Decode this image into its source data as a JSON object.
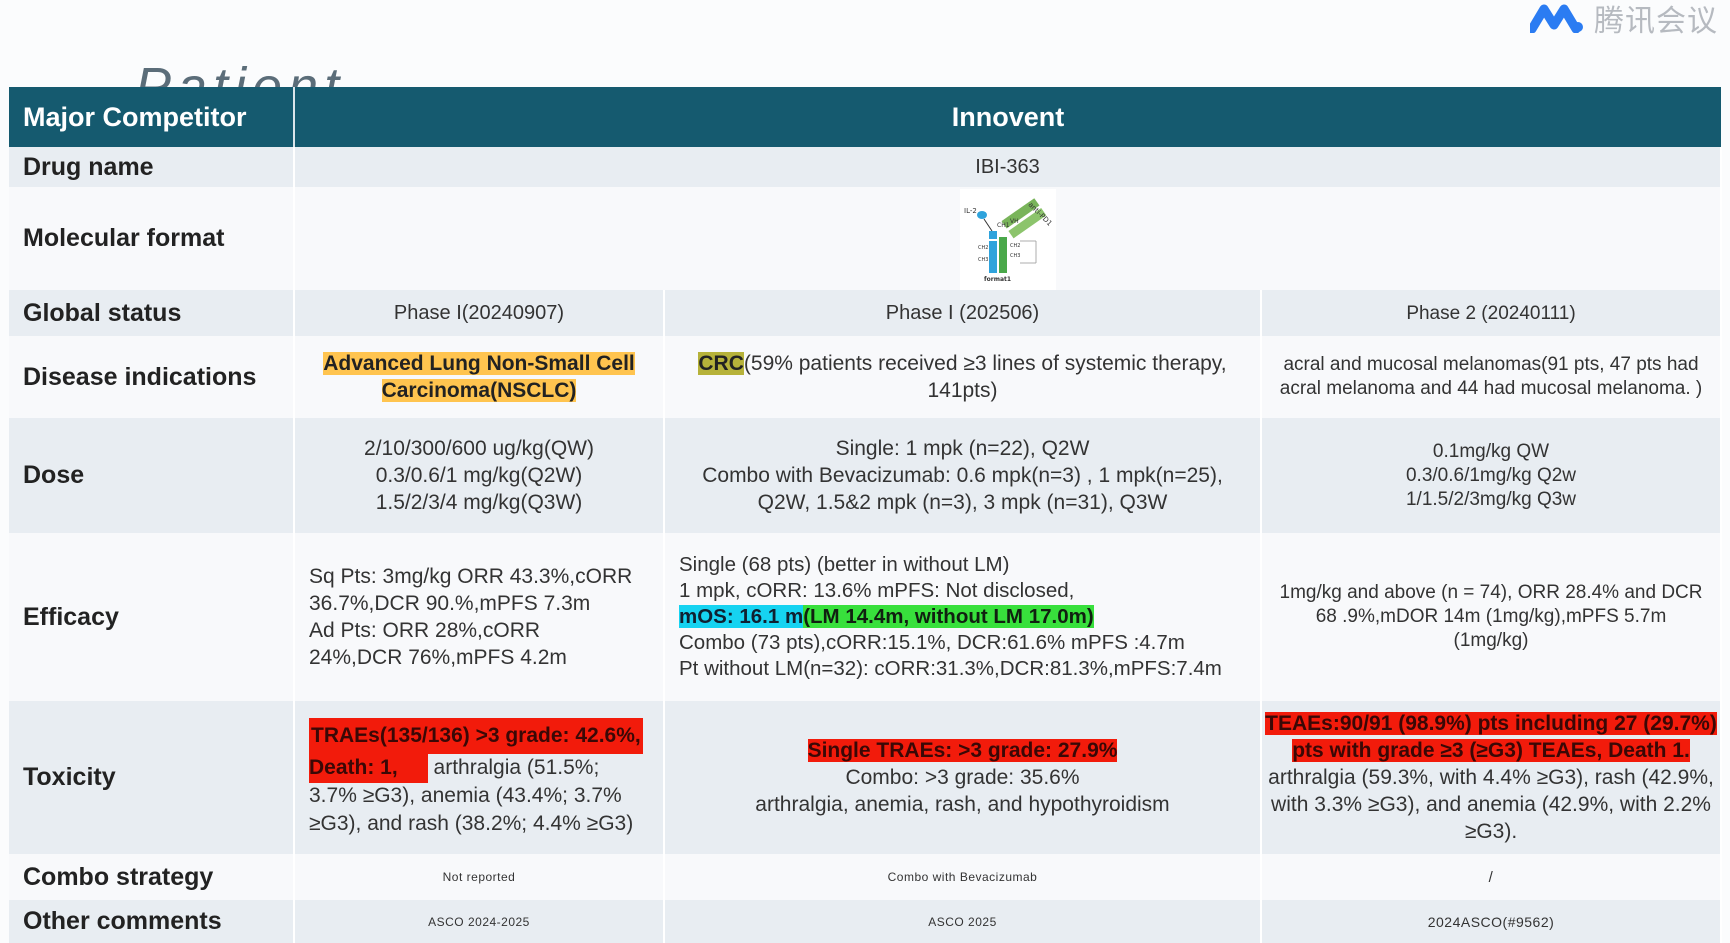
{
  "overlay": {
    "app_label": "腾讯会议",
    "ghost_title": "Patient selection"
  },
  "table": {
    "header": {
      "competitor_label": "Major Competitor",
      "company": "Innovent"
    },
    "rows": {
      "drug_name": {
        "label": "Drug name",
        "value": "IBI-363"
      },
      "molecular_format": {
        "label": "Molecular format",
        "diagram": {
          "il2": "IL-2",
          "anti_pd1": "anti-PD1",
          "ch1": "CH1",
          "ch2": "CH2",
          "ch3": "CH3",
          "vh": "VH",
          "bottom": "format1"
        }
      },
      "global_status": {
        "label": "Global status",
        "col1": "Phase I(20240907)",
        "col2": "Phase I (202506)",
        "col3": "Phase 2 (20240111)"
      },
      "disease_indications": {
        "label": "Disease indications",
        "col1": "Advanced Lung Non-Small Cell Carcinoma(NSCLC)",
        "col2_highlight": "CRC",
        "col2_rest": "(59% patients received ≥3 lines of systemic therapy, 141pts)",
        "col3": "acral and mucosal melanomas(91 pts, 47 pts had acral melanoma and 44 had mucosal melanoma. )"
      },
      "dose": {
        "label": "Dose",
        "col1": [
          "2/10/300/600 ug/kg(QW)",
          "0.3/0.6/1 mg/kg(Q2W)",
          "1.5/2/3/4 mg/kg(Q3W)"
        ],
        "col2": [
          "Single: 1 mpk (n=22), Q2W",
          "Combo with Bevacizumab: 0.6 mpk(n=3) , 1 mpk(n=25),",
          "Q2W, 1.5&2 mpk (n=3), 3 mpk (n=31), Q3W"
        ],
        "col3": [
          "0.1mg/kg QW",
          "0.3/0.6/1mg/kg Q2w",
          "1/1.5/2/3mg/kg Q3w"
        ]
      },
      "efficacy": {
        "label": "Efficacy",
        "col1": [
          "Sq Pts: 3mg/kg ORR 43.3%,cORR 36.7%,DCR 90.%,mPFS 7.3m",
          "Ad Pts: ORR 28%,cORR 24%,DCR 76%,mPFS 4.2m"
        ],
        "col2_lines": [
          "Single (68 pts) (better in without LM)",
          "1 mpk, cORR: 13.6% mPFS: Not disclosed,"
        ],
        "col2_cyan": "mOS: 16.1 m",
        "col2_green": "(LM 14.4m, without LM 17.0m)",
        "col2_after": [
          "Combo (73 pts),cORR:15.1%, DCR:61.6% mPFS :4.7m",
          "Pt without LM(n=32): cORR:31.3%,DCR:81.3%,mPFS:7.4m"
        ],
        "col3": "1mg/kg and above (n = 74),  ORR 28.4%  and DCR 68 .9%,mDOR 14m (1mg/kg),mPFS 5.7m (1mg/kg)"
      },
      "toxicity": {
        "label": "Toxicity",
        "col1_red1": "TRAEs(135/136) >3 grade: 42.6%,",
        "col1_red2": "Death: 1,",
        "col1_rest": " arthralgia (51.5%; 3.7% ≥G3), anemia (43.4%; 3.7% ≥G3), and rash (38.2%; 4.4% ≥G3)",
        "col2_red": "Single TRAEs: >3 grade: 27.9%",
        "col2_lines": [
          "Combo: >3 grade: 35.6%",
          "arthralgia, anemia, rash, and hypothyroidism"
        ],
        "col3_red1": "TEAEs:90/91 (98.9%) pts including 27 (29.7%)",
        "col3_red2": "pts with grade ≥3 (≥G3) TEAEs, Death 1.",
        "col3_rest": "arthralgia (59.3%, with 4.4% ≥G3), rash (42.9%, with 3.3% ≥G3), and anemia (42.9%, with 2.2% ≥G3)."
      },
      "combo_strategy": {
        "label": "Combo strategy",
        "col1": "Not reported",
        "col2": "Combo with Bevacizumab",
        "col3": "/"
      },
      "other_comments": {
        "label": "Other comments",
        "col1": "ASCO 2024-2025",
        "col2": "ASCO 2025",
        "col3": "2024ASCO(#9562)"
      }
    }
  },
  "colors": {
    "header_bg": "#155a6f",
    "row_odd": "#e8edf2",
    "row_even": "#f8f9fb",
    "highlight_orange": "#ffc44f",
    "highlight_red": "#f21b0b",
    "highlight_cyan": "#16d3f1",
    "highlight_green": "#38e03c"
  },
  "icons": {
    "logo": "tencent-meeting-logo-icon",
    "diagram": "bispecific-antibody-diagram-icon"
  }
}
